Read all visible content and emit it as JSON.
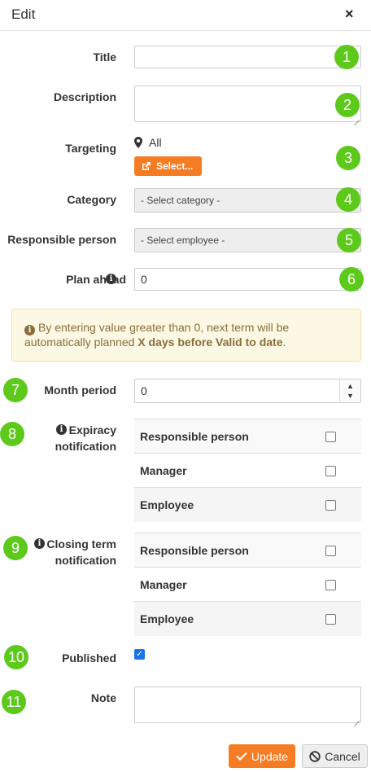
{
  "header": {
    "title": "Edit",
    "close_label": "×"
  },
  "fields": {
    "title": {
      "label": "Title",
      "value": ""
    },
    "description": {
      "label": "Description",
      "value": ""
    },
    "targeting": {
      "label": "Targeting",
      "value": "All",
      "select_button": "Select..."
    },
    "category": {
      "label": "Category",
      "value": "- Select category -"
    },
    "responsible": {
      "label": "Responsible person",
      "value": "- Select employee -"
    },
    "plan_ahead": {
      "label": "Plan ahead",
      "value": "0"
    },
    "month_period": {
      "label": "Month period",
      "value": "0"
    },
    "expiracy": {
      "label_line1": "Expiracy",
      "label_line2": "notification",
      "rows": [
        {
          "label": "Responsible person",
          "checked": false
        },
        {
          "label": "Manager",
          "checked": false
        },
        {
          "label": "Employee",
          "checked": false
        }
      ]
    },
    "closing": {
      "label_line1": "Closing term",
      "label_line2": "notification",
      "rows": [
        {
          "label": "Responsible person",
          "checked": false
        },
        {
          "label": "Manager",
          "checked": false
        },
        {
          "label": "Employee",
          "checked": false
        }
      ]
    },
    "published": {
      "label": "Published",
      "checked": true
    },
    "note": {
      "label": "Note",
      "value": ""
    }
  },
  "alert": {
    "text_before": "By entering value greater than 0, next term will be automatically planned ",
    "text_bold": "X days before Valid to date",
    "text_after": "."
  },
  "badges": [
    "1",
    "2",
    "3",
    "4",
    "5",
    "6",
    "7",
    "8",
    "9",
    "10",
    "11"
  ],
  "buttons": {
    "update": "Update",
    "cancel": "Cancel"
  },
  "colors": {
    "accent": "#f57c22",
    "badge": "#5cc91b",
    "alert_bg": "#fcf8e3",
    "checkbox": "#1a73e8"
  }
}
